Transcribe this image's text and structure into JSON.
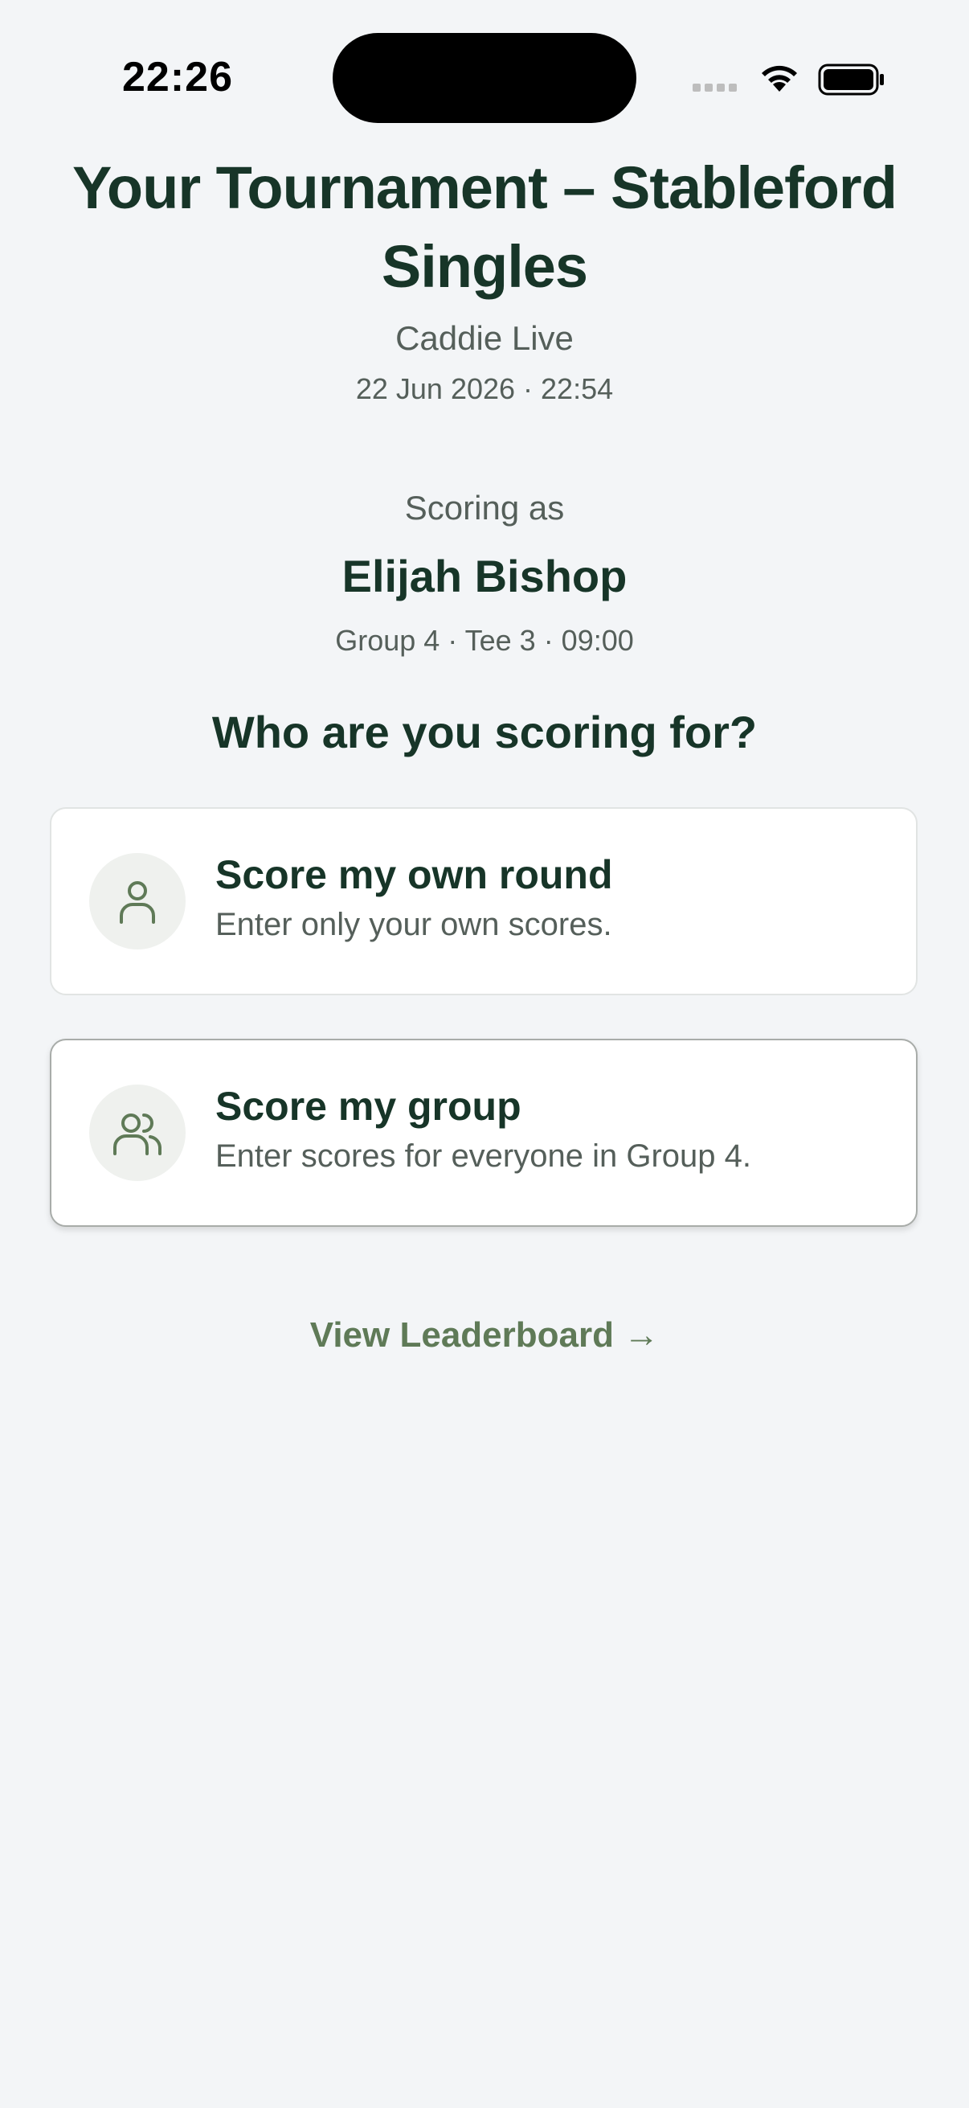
{
  "status_bar": {
    "time": "22:26"
  },
  "header": {
    "title": "Your Tournament – Stableford Singles",
    "subtitle": "Caddie Live",
    "datetime": "22 Jun 2026 · 22:54"
  },
  "scoring": {
    "label": "Scoring as",
    "player_name": "Elijah Bishop",
    "player_meta": "Group 4 · Tee 3 · 09:00",
    "question": "Who are you scoring for?"
  },
  "options": [
    {
      "title": "Score my own round",
      "description": "Enter only your own scores.",
      "icon": "user-icon"
    },
    {
      "title": "Score my group",
      "description": "Enter scores for everyone in Group 4.",
      "icon": "users-icon"
    }
  ],
  "footer": {
    "leaderboard_link": "View Leaderboard →"
  },
  "colors": {
    "background": "#f3f5f7",
    "primary_text": "#173528",
    "secondary_text": "#555f5a",
    "accent": "#5f7a57"
  }
}
